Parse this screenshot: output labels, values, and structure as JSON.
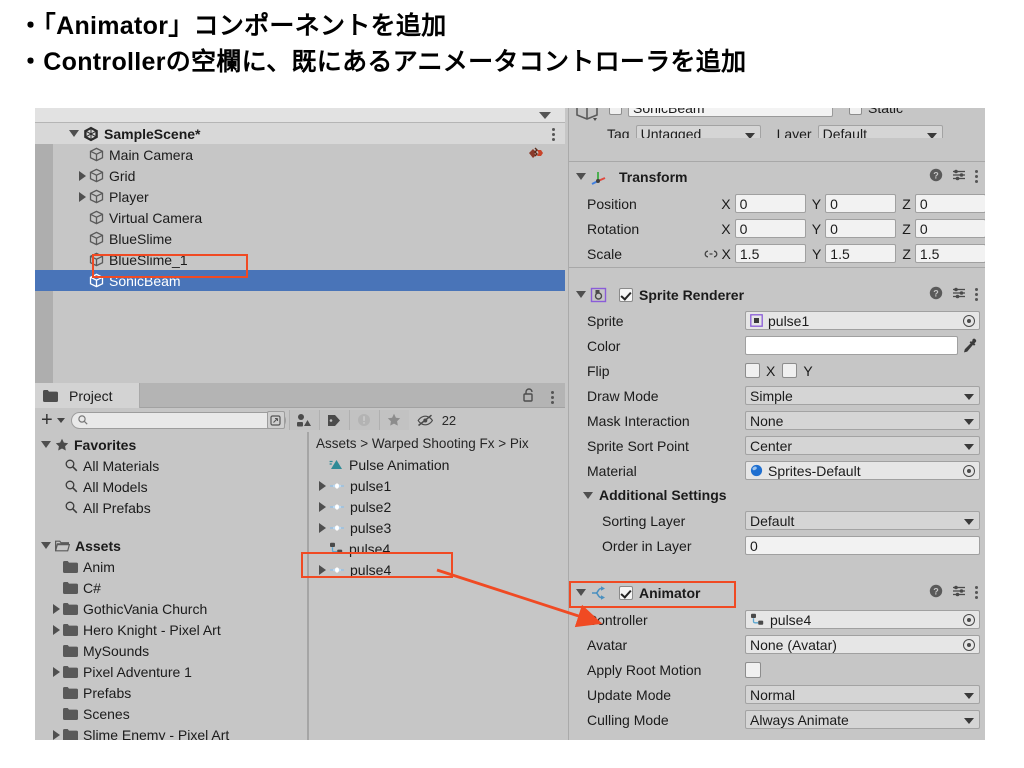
{
  "slide": {
    "lines": [
      "・「Animator」コンポーネントを追加",
      "・Controllerの空欄に、既にあるアニメータコントローラを追加"
    ]
  },
  "hierarchy": {
    "scene": {
      "label": "SampleScene*",
      "icon": "unity-scene-icon",
      "expanded": true
    },
    "items": [
      {
        "label": "Main Camera",
        "icon": "gameobject-icon",
        "arrow": "none",
        "selected": false,
        "badge": "prefab-broken-icon"
      },
      {
        "label": "Grid",
        "icon": "gameobject-icon",
        "arrow": "collapsed",
        "selected": false
      },
      {
        "label": "Player",
        "icon": "gameobject-icon",
        "arrow": "collapsed",
        "selected": false
      },
      {
        "label": "Virtual Camera",
        "icon": "gameobject-icon",
        "arrow": "none",
        "selected": false
      },
      {
        "label": "BlueSlime",
        "icon": "gameobject-icon",
        "arrow": "none",
        "selected": false
      },
      {
        "label": "BlueSlime_1",
        "icon": "gameobject-icon",
        "arrow": "none",
        "selected": false
      },
      {
        "label": "SonicBeam",
        "icon": "gameobject-icon",
        "arrow": "none",
        "selected": true
      }
    ],
    "menu_icon": "kebab-menu-icon"
  },
  "project": {
    "tab_label": "Project",
    "tab_icon": "folder-icon",
    "lock_icon": "lock-open-icon",
    "menu_icon": "kebab-menu-icon",
    "toolbar": {
      "add_label": "+",
      "add_dropdown_icon": "chevron-down-icon",
      "search_placeholder": "",
      "search_value": "",
      "search_icon": "search-icon",
      "buttons": [
        {
          "name": "search-by-type-icon"
        },
        {
          "name": "search-by-label-icon"
        },
        {
          "name": "warning-filter-icon"
        },
        {
          "name": "favorites-star-icon"
        }
      ],
      "hidden_icon": "eye-off-icon",
      "hidden_count": "22"
    },
    "favorites": {
      "label": "Favorites",
      "icon": "star-icon",
      "expanded": true,
      "items": [
        {
          "label": "All Materials",
          "icon": "search-icon"
        },
        {
          "label": "All Models",
          "icon": "search-icon"
        },
        {
          "label": "All Prefabs",
          "icon": "search-icon"
        }
      ]
    },
    "assets": {
      "label": "Assets",
      "icon": "open-folder-icon",
      "expanded": true,
      "items": [
        {
          "label": "Anim",
          "arrow": "none"
        },
        {
          "label": "C#",
          "arrow": "none"
        },
        {
          "label": "GothicVania Church",
          "arrow": "collapsed"
        },
        {
          "label": "Hero Knight - Pixel Art",
          "arrow": "collapsed"
        },
        {
          "label": "MySounds",
          "arrow": "none"
        },
        {
          "label": "Pixel Adventure 1",
          "arrow": "collapsed"
        },
        {
          "label": "Prefabs",
          "arrow": "none"
        },
        {
          "label": "Scenes",
          "arrow": "none"
        },
        {
          "label": "Slime Enemy - Pixel Art",
          "arrow": "collapsed"
        }
      ]
    },
    "breadcrumb": [
      "Assets",
      "Warped Shooting Fx",
      "Pix"
    ],
    "breadcrumb_text": "Assets  >  Warped Shooting Fx  >  Pix",
    "asset_items": [
      {
        "label": "Pulse Animation",
        "icon": "animation-clip-icon",
        "arrow": "none",
        "highlight": false
      },
      {
        "label": "pulse1",
        "icon": "sprite-sheet-icon",
        "arrow": "collapsed",
        "highlight": false
      },
      {
        "label": "pulse2",
        "icon": "sprite-sheet-icon",
        "arrow": "collapsed",
        "highlight": false
      },
      {
        "label": "pulse3",
        "icon": "sprite-sheet-icon",
        "arrow": "collapsed",
        "highlight": false
      },
      {
        "label": "pulse4",
        "icon": "animator-controller-icon",
        "arrow": "none",
        "highlight": true
      },
      {
        "label": "pulse4",
        "icon": "sprite-sheet-icon",
        "arrow": "collapsed",
        "highlight": false
      }
    ]
  },
  "inspector": {
    "object_name": "SonicBeam",
    "static_label": "Static",
    "tag_label": "Tag",
    "tag_value": "Untagged",
    "layer_label": "Layer",
    "layer_value": "Default",
    "transform": {
      "title": "Transform",
      "icon": "transform-icon",
      "rows": [
        {
          "label": "Position",
          "x": "0",
          "y": "0",
          "z": "0",
          "linked": false
        },
        {
          "label": "Rotation",
          "x": "0",
          "y": "0",
          "z": "0",
          "linked": false
        },
        {
          "label": "Scale",
          "x": "1.5",
          "y": "1.5",
          "z": "1.5",
          "linked": true
        }
      ],
      "axis_labels": [
        "X",
        "Y",
        "Z"
      ]
    },
    "sprite_renderer": {
      "title": "Sprite Renderer",
      "icon": "sprite-renderer-icon",
      "enabled": true,
      "fields": [
        {
          "label": "Sprite",
          "value": "pulse1",
          "type": "object",
          "icon": "sprite-icon"
        },
        {
          "label": "Color",
          "value": "",
          "type": "color",
          "icon": "eyedropper-icon"
        },
        {
          "label": "Flip",
          "value": "",
          "type": "flip",
          "flip_x_label": "X",
          "flip_y_label": "Y"
        },
        {
          "label": "Draw Mode",
          "value": "Simple",
          "type": "dropdown"
        },
        {
          "label": "Mask Interaction",
          "value": "None",
          "type": "dropdown"
        },
        {
          "label": "Sprite Sort Point",
          "value": "Center",
          "type": "dropdown"
        },
        {
          "label": "Material",
          "value": "Sprites-Default",
          "type": "object",
          "icon": "material-ball-icon"
        }
      ],
      "additional_settings": {
        "title": "Additional Settings",
        "fields": [
          {
            "label": "Sorting Layer",
            "value": "Default",
            "type": "dropdown"
          },
          {
            "label": "Order in Layer",
            "value": "0",
            "type": "text"
          }
        ]
      }
    },
    "animator": {
      "title": "Animator",
      "icon": "animator-icon",
      "enabled": true,
      "fields": [
        {
          "label": "Controller",
          "value": "pulse4",
          "type": "object",
          "icon": "animator-controller-icon"
        },
        {
          "label": "Avatar",
          "value": "None (Avatar)",
          "type": "object"
        },
        {
          "label": "Apply Root Motion",
          "value": "",
          "type": "checkbox",
          "checked": false
        },
        {
          "label": "Update Mode",
          "value": "Normal",
          "type": "dropdown"
        },
        {
          "label": "Culling Mode",
          "value": "Always Animate",
          "type": "dropdown"
        }
      ]
    },
    "header_icons": [
      "help-icon",
      "preset-icon",
      "kebab-menu-icon"
    ]
  },
  "annotations": {
    "color": "#f04a23",
    "boxes": [
      "sonicbeam-hierarchy-row",
      "pulse4-asset-row",
      "animator-component-header"
    ],
    "arrow": "pulse4-to-controller-arrow"
  }
}
